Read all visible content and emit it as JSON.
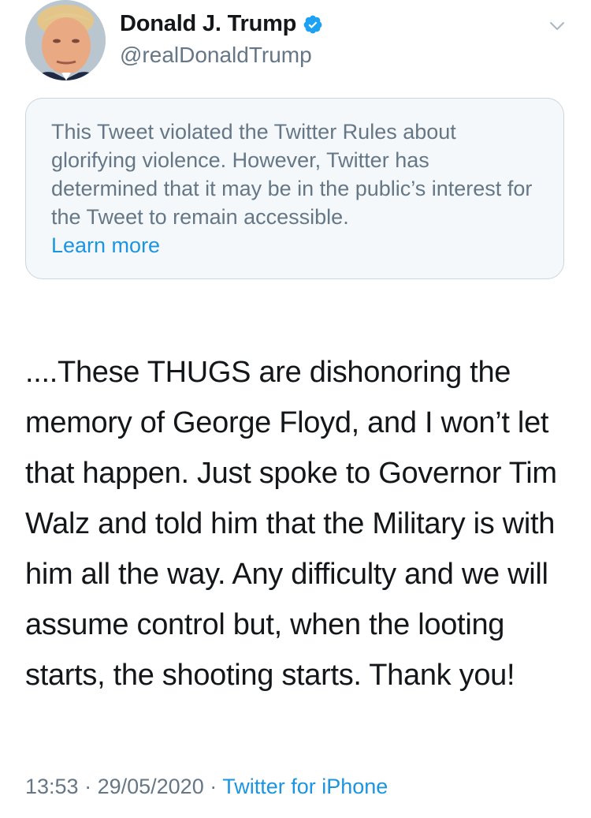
{
  "author": {
    "display_name": "Donald J. Trump",
    "handle": "@realDonaldTrump",
    "verified": true,
    "avatar_icon": "profile-photo"
  },
  "notice": {
    "text": "This Tweet violated the Twitter Rules about glorifying violence. However, Twitter has determined that it may be in the public’s interest for the Tweet to remain accessible.",
    "link_label": "Learn more"
  },
  "tweet": {
    "text": "....These THUGS are dishonoring the memory of George Floyd, and I won’t let that happen. Just spoke to Governor Tim Walz and told him that the Military is with him all the way. Any difficulty and we will assume control but, when the looting starts, the shooting starts. Thank you!"
  },
  "meta": {
    "time": "13:53",
    "separator": " · ",
    "date": "29/05/2020",
    "source": "Twitter for iPhone"
  },
  "colors": {
    "text_primary": "#14171a",
    "text_secondary": "#657786",
    "link": "#1b95e0",
    "verified": "#1da1f2",
    "notice_bg": "#f5f8fa",
    "notice_border": "#ccd6dd"
  }
}
